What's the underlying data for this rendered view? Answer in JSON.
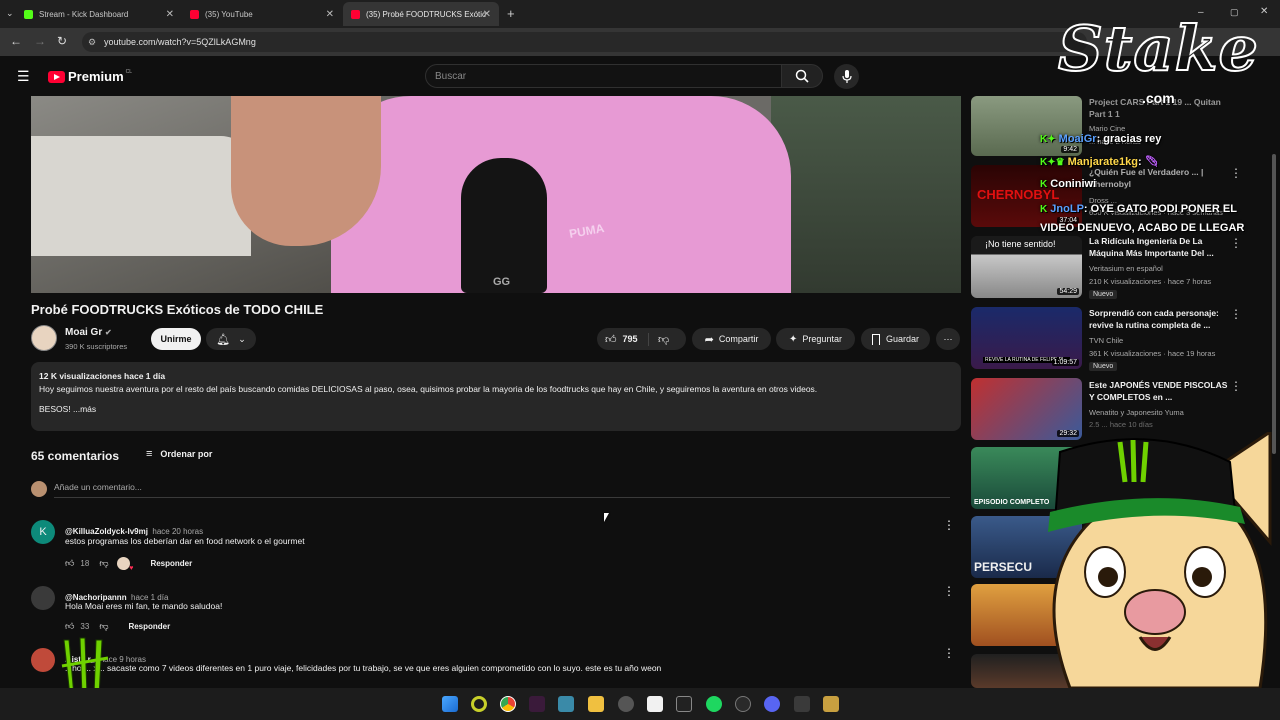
{
  "browser": {
    "tabs": [
      {
        "label": "Stream - Kick Dashboard",
        "color": "#53fc18"
      },
      {
        "label": "(35) YouTube",
        "color": "#ff0033"
      },
      {
        "label": "(35) Probé FOODTRUCKS Exótic",
        "color": "#ff0033"
      }
    ],
    "new_tab": "+",
    "url": "youtube.com/watch?v=5QZlLkAGMng"
  },
  "youtube": {
    "logo": "Premium",
    "logo_region": "CL",
    "search_placeholder": "Buscar"
  },
  "video": {
    "logo_text": "GG",
    "shirt_text": "PUMA",
    "title": "Probé FOODTRUCKS Exóticos de TODO CHILE",
    "channel": "Moai Gr",
    "subscribers": "390 K suscriptores",
    "join_label": "Unirme",
    "likes": "795",
    "share_label": "Compartir",
    "ask_label": "Preguntar",
    "save_label": "Guardar",
    "more": "⋯"
  },
  "description": {
    "views_date": "12 K visualizaciones  hace 1 día",
    "text": "Hoy seguimos nuestra aventura por el resto del país buscando comidas DELICIOSAS al paso, osea, quisimos probar la mayoria de los foodtrucks que hay en Chile, y seguiremos la aventura en otros videos.",
    "text2": "BESOS! ...más"
  },
  "comments": {
    "count": "65 comentarios",
    "sort_label": "Ordenar por",
    "add_placeholder": "Añade un comentario...",
    "reply": "Responder",
    "items": [
      {
        "initial": "K",
        "author": "@KilluaZoldyck-lv9mj",
        "time": "hace 20 horas",
        "text": "estos programas los deberían dar en food network o el gourmet",
        "likes": "18"
      },
      {
        "initial": "",
        "author": "@Nachoripannn",
        "time": "hace 1 día",
        "text": "Hola Moai eres mi fan, te mando saludoa!",
        "likes": "33"
      },
      {
        "initial": "",
        "author": "...ist...r_",
        "time": "hace 9 horas",
        "text": "...ho ... x... sacaste como 7 videos diferentes en 1 puro viaje, felicidades por tu trabajo, se ve que eres alguien comprometido con lo suyo. este es tu año weon",
        "likes": ""
      }
    ]
  },
  "sidebar": {
    "items": [
      {
        "title": "Project CARS Part 1 19 ... Quitan Part 1 1",
        "channel": "Mario Cine",
        "meta": "... hace 2 horas",
        "duration": "9:42",
        "badge": "",
        "color": "#5a6a50"
      },
      {
        "title": "¿Quién Fue el Verdadero ... | Chernobyl",
        "channel": "Dross ...",
        "meta": "650 K visualizaciones · hace 3 semanas",
        "duration": "37:04",
        "badge": "",
        "color": "#3a0808",
        "thumb_text": "CHERNOBYL"
      },
      {
        "title": "La Ridícula Ingeniería De La Máquina Más Importante Del ...",
        "channel": "Veritasium en español",
        "meta": "210 K visualizaciones · hace 7 horas",
        "duration": "54:29",
        "badge": "Nuevo",
        "color": "#b8b8b8",
        "thumb_text": "¡No tiene sentido!"
      },
      {
        "title": "Sorprendió con cada personaje: revive la rutina completa de ...",
        "channel": "TVN Chile",
        "meta": "361 K visualizaciones · hace 19 horas",
        "duration": "1:09:57",
        "badge": "Nuevo",
        "color": "#1a2a6a",
        "thumb_text": "REVIVE LA RUTINA DE FELIPE PI..."
      },
      {
        "title": "Este JAPONÉS VENDE PISCOLAS Y COMPLETOS en ...",
        "channel": "Wenatito y Japonesito Yuma",
        "meta": "2.5 ... hace 10 días",
        "duration": "29:32",
        "badge": "",
        "color": "#b02020"
      },
      {
        "title": "",
        "channel": "",
        "meta": "",
        "duration": "",
        "badge": "",
        "color": "#2a6a4a",
        "thumb_text": "EPISODIO COMPLETO"
      },
      {
        "title": "",
        "channel": "",
        "meta": "",
        "duration": "",
        "badge": "",
        "color": "#2a3e6a",
        "thumb_text": "PERSECU"
      },
      {
        "title": "",
        "channel": "",
        "meta": "",
        "duration": "",
        "badge": "",
        "color": "#c87a30"
      }
    ]
  },
  "overlay": {
    "stake_logo": "Stake",
    "stake_sub": ".com",
    "chat": [
      {
        "user": "MoaiGr",
        "msg": ": gracias rey",
        "color": "#5aa0ff"
      },
      {
        "user": "Manjarate1kg",
        "msg": ":",
        "color": "#ffd84a"
      },
      {
        "user": "Coniniwi",
        "msg": "",
        "color": "#ffffff"
      },
      {
        "user": "JnoLP",
        "msg": ": OYE GATO PODI PONER EL VIDEO DENUEVO, ACABO DE LLEGAR",
        "color": "#5aa0ff"
      }
    ]
  },
  "taskbar": {
    "apps": [
      "windows",
      "opera",
      "chrome",
      "vpn",
      "files-app",
      "explorer",
      "spotify-like",
      "capcut",
      "logitech",
      "spotify",
      "steam",
      "discord",
      "app",
      "folder"
    ]
  }
}
